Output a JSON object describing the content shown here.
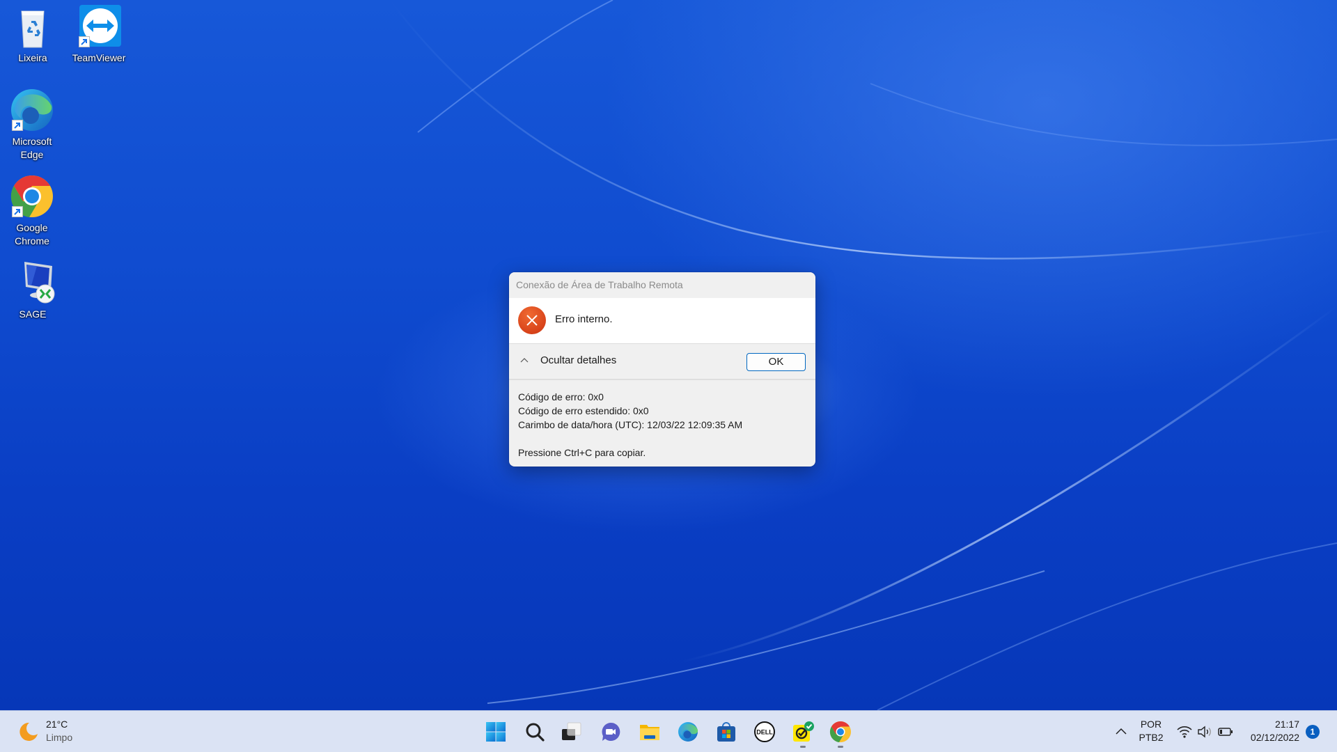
{
  "desktop": {
    "icons": [
      {
        "label": "Lixeira",
        "icon": "recycle-bin-icon"
      },
      {
        "label": "TeamViewer",
        "icon": "teamviewer-icon",
        "shortcut": true
      },
      {
        "label": "Microsoft Edge",
        "icon": "edge-icon",
        "shortcut": true
      },
      {
        "label": "Google Chrome",
        "icon": "chrome-icon",
        "shortcut": true
      },
      {
        "label": "SAGE",
        "icon": "remote-desktop-icon"
      }
    ]
  },
  "dialog": {
    "title": "Conexão de Área de Trabalho Remota",
    "message": "Erro interno.",
    "toggle_label": "Ocultar detalhes",
    "ok_label": "OK",
    "details": {
      "error_code": "Código de erro: 0x0",
      "extended_error_code": "Código de erro estendido: 0x0",
      "timestamp": "Carimbo de data/hora (UTC): 12/03/22 12:09:35 AM",
      "copy_hint": "Pressione Ctrl+C para copiar."
    },
    "colors": {
      "error_icon": "#d8431a",
      "ok_border": "#0067c0"
    }
  },
  "taskbar": {
    "weather": {
      "temperature": "21°C",
      "condition": "Limpo",
      "icon": "moon-icon"
    },
    "apps": [
      {
        "name": "start",
        "icon": "windows-start-icon"
      },
      {
        "name": "search",
        "icon": "search-icon"
      },
      {
        "name": "task-view",
        "icon": "task-view-icon"
      },
      {
        "name": "chat",
        "icon": "teams-chat-icon"
      },
      {
        "name": "file-explorer",
        "icon": "folder-icon"
      },
      {
        "name": "edge",
        "icon": "edge-icon"
      },
      {
        "name": "microsoft-store",
        "icon": "store-icon"
      },
      {
        "name": "dell",
        "icon": "dell-icon"
      },
      {
        "name": "norton",
        "icon": "norton-icon",
        "running": true
      },
      {
        "name": "chrome",
        "icon": "chrome-icon",
        "running": true
      }
    ],
    "tray": {
      "language_top": "POR",
      "language_bottom": "PTB2",
      "time": "21:17",
      "date": "02/12/2022",
      "notification_count": "1"
    }
  }
}
